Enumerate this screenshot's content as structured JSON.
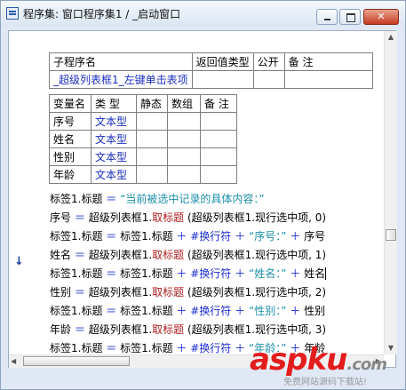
{
  "window": {
    "title": "程序集: 窗口程序集1 / _启动窗口"
  },
  "table1": {
    "headers": [
      "子程序名",
      "返回值类型",
      "公开",
      "备 注"
    ],
    "row": [
      "_超级列表框1_左键单击表项",
      "",
      "",
      ""
    ]
  },
  "table2": {
    "headers": [
      "变量名",
      "类 型",
      "静态",
      "数组",
      "备 注"
    ],
    "rows": [
      [
        "序号",
        "文本型",
        "",
        "",
        ""
      ],
      [
        "姓名",
        "文本型",
        "",
        "",
        ""
      ],
      [
        "性别",
        "文本型",
        "",
        "",
        ""
      ],
      [
        "年龄",
        "文本型",
        "",
        "",
        ""
      ]
    ]
  },
  "code": {
    "l1": {
      "a": "标签1.标题",
      "eq": "＝",
      "str": "“当前被选中记录的具体内容：”"
    },
    "l2": {
      "a": "序号",
      "eq": "＝",
      "b": "超级列表框1.",
      "cmd": "取标题",
      "args": "(超级列表框1.现行选中项, 0)"
    },
    "l3": {
      "a": "标签1.标题",
      "eq": "＝",
      "b": "标签1.标题",
      "p1": "＋",
      "c": "#换行符",
      "p2": "＋",
      "str": "“序号：”",
      "p3": "＋",
      "d": "序号"
    },
    "l4": {
      "a": "姓名",
      "eq": "＝",
      "b": "超级列表框1.",
      "cmd": "取标题",
      "args": "(超级列表框1.现行选中项, 1)"
    },
    "l5": {
      "a": "标签1.标题",
      "eq": "＝",
      "b": "标签1.标题",
      "p1": "＋",
      "c": "#换行符",
      "p2": "＋",
      "str": "“姓名：”",
      "p3": "＋",
      "d": "姓名"
    },
    "l6": {
      "a": "性别",
      "eq": "＝",
      "b": "超级列表框1.",
      "cmd": "取标题",
      "args": "(超级列表框1.现行选中项, 2)"
    },
    "l7": {
      "a": "标签1.标题",
      "eq": "＝",
      "b": "标签1.标题",
      "p1": "＋",
      "c": "#换行符",
      "p2": "＋",
      "str": "“性别：”",
      "p3": "＋",
      "d": "性别"
    },
    "l8": {
      "a": "年龄",
      "eq": "＝",
      "b": "超级列表框1.",
      "cmd": "取标题",
      "args": "(超级列表框1.现行选中项, 3)"
    },
    "l9": {
      "a": "标签1.标题",
      "eq": "＝",
      "b": "标签1.标题",
      "p1": "＋",
      "c": "#换行符",
      "p2": "＋",
      "str": "“年龄：”",
      "p3": "＋",
      "d": "年龄"
    }
  },
  "watermark": {
    "text": "asp",
    "text2": "ku",
    "dot": ".com",
    "sub": "免费网站源码下载站!"
  },
  "colors": {
    "keyword": "#1b2bd6",
    "string": "#1b8fa8",
    "command": "#b02020"
  }
}
